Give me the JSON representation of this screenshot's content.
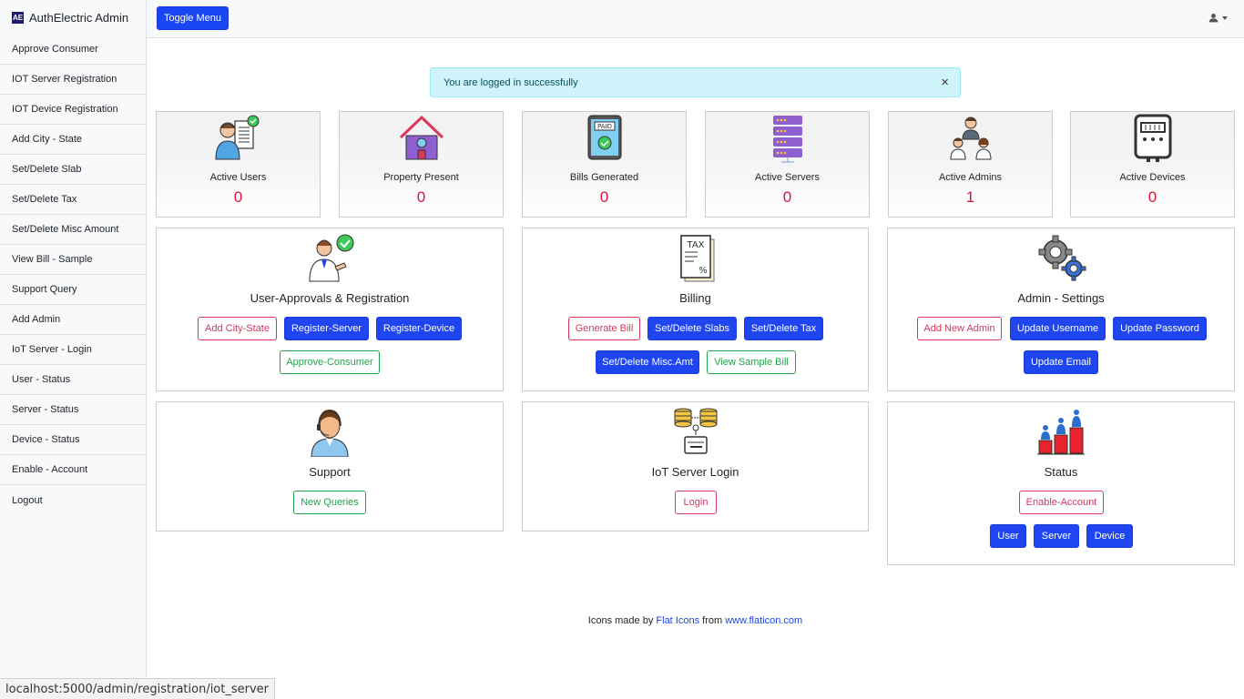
{
  "sidebar": {
    "brand": "AuthElectric Admin",
    "brand_logo": "AE",
    "items": [
      {
        "label": "Approve Consumer"
      },
      {
        "label": "IOT Server Registration"
      },
      {
        "label": "IOT Device Registration"
      },
      {
        "label": "Add City - State"
      },
      {
        "label": "Set/Delete Slab"
      },
      {
        "label": "Set/Delete Tax"
      },
      {
        "label": "Set/Delete Misc Amount"
      },
      {
        "label": "View Bill - Sample"
      },
      {
        "label": "Support Query"
      },
      {
        "label": "Add Admin"
      },
      {
        "label": "IoT Server - Login"
      },
      {
        "label": "User - Status"
      },
      {
        "label": "Server - Status"
      },
      {
        "label": "Device - Status"
      },
      {
        "label": "Enable - Account"
      },
      {
        "label": "Logout"
      }
    ]
  },
  "topbar": {
    "toggle_label": "Toggle Menu",
    "user_icon": "user-icon"
  },
  "alert": {
    "message": "You are logged in successfully",
    "close": "×"
  },
  "stats": [
    {
      "label": "Active Users",
      "value": "0",
      "icon": "user-document-icon"
    },
    {
      "label": "Property Present",
      "value": "0",
      "icon": "house-icon"
    },
    {
      "label": "Bills Generated",
      "value": "0",
      "icon": "paid-bill-icon"
    },
    {
      "label": "Active Servers",
      "value": "0",
      "icon": "server-icon"
    },
    {
      "label": "Active Admins",
      "value": "1",
      "icon": "admins-icon"
    },
    {
      "label": "Active Devices",
      "value": "0",
      "icon": "meter-icon"
    }
  ],
  "panels": {
    "registration": {
      "title": "User-Approvals & Registration",
      "buttons": {
        "city_state": "Add City-State",
        "server": "Register-Server",
        "device": "Register-Device",
        "approve": "Approve-Consumer"
      }
    },
    "billing": {
      "title": "Billing",
      "buttons": {
        "generate": "Generate Bill",
        "slabs": "Set/Delete Slabs",
        "tax": "Set/Delete Tax",
        "misc": "Set/Delete Misc.Amt",
        "sample": "View Sample Bill"
      }
    },
    "admin": {
      "title": "Admin - Settings",
      "buttons": {
        "add_admin": "Add New Admin",
        "username": "Update Username",
        "password": "Update Password",
        "email": "Update Email"
      }
    },
    "support": {
      "title": "Support",
      "buttons": {
        "queries": "New Queries"
      }
    },
    "iot_login": {
      "title": "IoT Server Login",
      "buttons": {
        "login": "Login"
      }
    },
    "status": {
      "title": "Status",
      "buttons": {
        "enable": "Enable-Account",
        "user": "User",
        "server": "Server",
        "device": "Device"
      }
    }
  },
  "footer": {
    "prefix": "Icons made by",
    "author": "Flat Icons",
    "middle": "from",
    "site": "www.flaticon.com"
  },
  "status_url": "localhost:5000/admin/registration/iot_server",
  "colors": {
    "primary": "#1e45f0",
    "danger": "#d9365c",
    "success": "#20a34a",
    "stat_value": "#dc143c",
    "alert_bg": "#cff4fc"
  }
}
